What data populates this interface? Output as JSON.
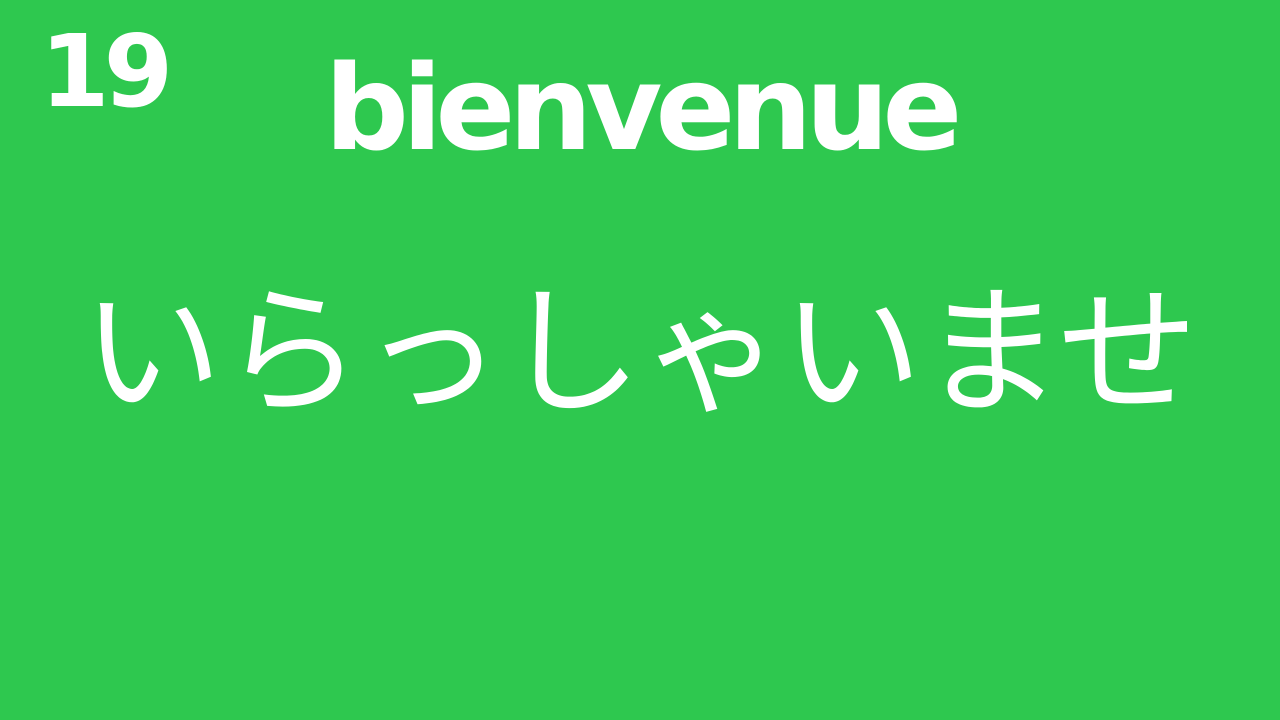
{
  "colors": {
    "background": "#2ec84f",
    "text": "#ffffff"
  },
  "slide": {
    "number": "19",
    "word_french": "bienvenue",
    "word_japanese": "いらっしゃいませ"
  }
}
